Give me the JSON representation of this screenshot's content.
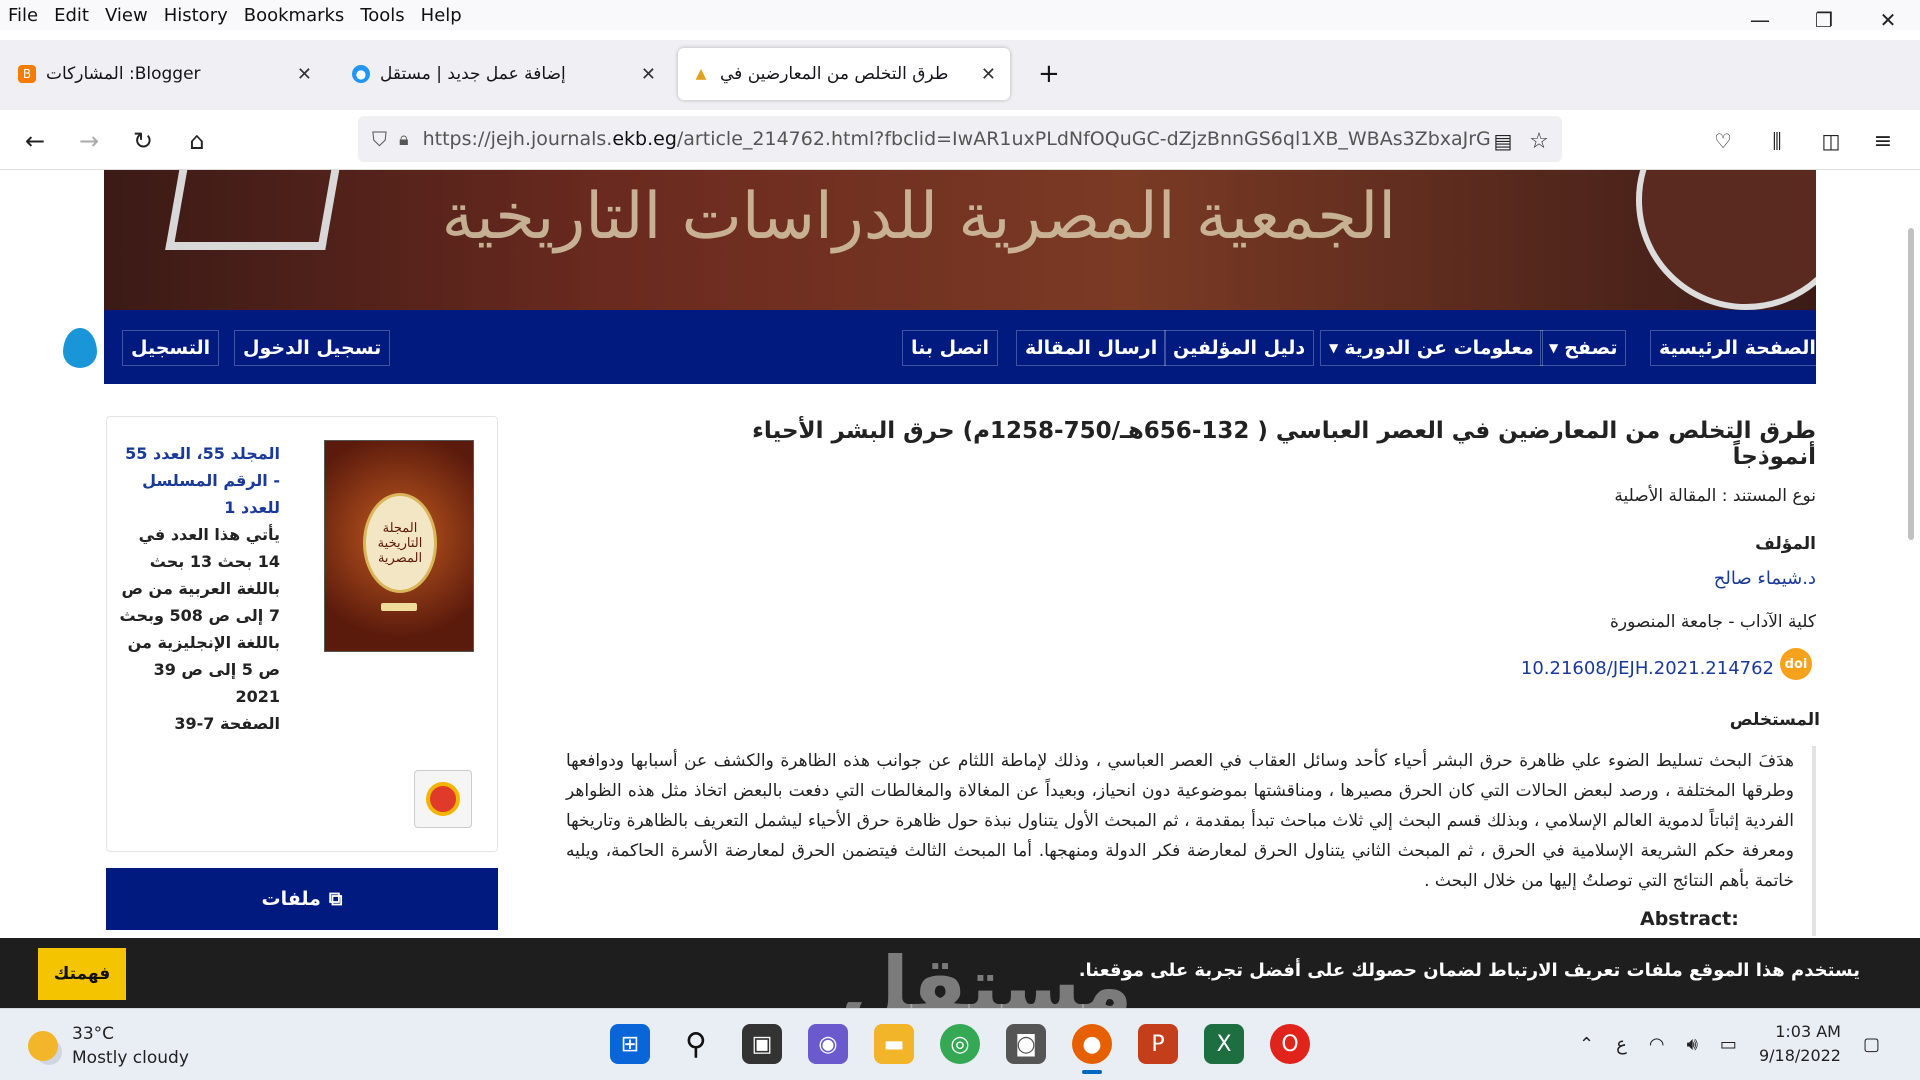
{
  "menu": [
    "File",
    "Edit",
    "View",
    "History",
    "Bookmarks",
    "Tools",
    "Help"
  ],
  "tabs": [
    {
      "title": "Blogger: المشاركات",
      "favicon": "blogger-icon",
      "color": "#f57c00"
    },
    {
      "title": "إضافة عمل جديد | مستقل",
      "favicon": "mostaql-icon",
      "color": "#2196f3"
    },
    {
      "title": "طرق التخلص من المعارضين في",
      "favicon": "journal-icon",
      "color": "#e0a020"
    }
  ],
  "new_tab": "+",
  "url": {
    "scheme": "https://jejh.journals.",
    "host": "ekb.eg",
    "path": "/article_214762.html?fbclid=IwAR1uxPLdNfOQuGC-dZjzBnnGS6ql1XB_WBAs3ZbxaJrG"
  },
  "banner": {
    "text": "الجمعية المصرية للدراسات التاريخية"
  },
  "site_nav": [
    "الصفحة الرئيسية",
    "تصفح",
    "معلومات عن الدورية",
    "دليل المؤلفين",
    "ارسال المقالة",
    "اتصل بنا",
    "تسجيل الدخول",
    "التسجيل"
  ],
  "article": {
    "title": "طرق التخلص من المعارضين في العصر العباسي ( 132-656هـ/750-1258م) حرق البشر الأحياء أنموذجاً",
    "doc_type": "نوع المستند : المقالة الأصلية",
    "author_label": "المؤلف",
    "author": "د.شيماء صالح",
    "affiliation": "كلية الآداب - جامعة المنصورة",
    "doi": "10.21608/JEJH.2021.214762",
    "doi_badge": "doi",
    "abstract_label": "المستخلص",
    "abstract": "هدَفَ البحث  تسليط الضوء علي ظاهرة  حرق البشر أحياء كأحد وسائل العقاب في العصر العباسي ، وذلك لإماطة اللثام عن جوانب هذه الظاهرة والكشف عن أسبابها ودوافعها وطرقها المختلفة ، ورصد لبعض الحالات التي كان الحرق مصيرها ، ومناقشتها بموضوعية دون انحياز،  وبعيداً عن المغالاة والمغالطات التي دفعت بالبعض اتخاذ مثل هذه الظواهر الفردية إثباتاً لدموية العالم الإسلامي ، وبذلك قسم البحث إلي ثلاث مباحث تبدأ بمقدمة ،  ثم  المبحث الأول يتناول نبذة حول ظاهرة حرق الأحياء ليشمل التعريف بالظاهرة وتاريخها ومعرفة حكم الشريعة الإسلامية في الحرق ،  ثم  المبحث الثاني يتناول الحرق لمعارضة فكر الدولة ومنهجها.  أما  المبحث الثالث فيتضمن الحرق لمعارضة الأسرة الحاكمة، ويليه خاتمة بأهم النتائج التي توصلتُ إليها من خلال البحث .",
    "abstract_en_label": "Abstract:"
  },
  "sidebar": {
    "cover_title": "المجلة التاريخية المصرية",
    "issue_link": "المجلد 55، العدد 55 - الرقم المسلسل للعدد 1",
    "issue_desc": "يأتي هذا العدد في 14 بحث 13 بحث باللغة العربية من ص 7 إلى ص 508 وبحث باللغة الإنجليزية من ص 5 إلى ص 39",
    "year": "2021",
    "pages": "الصفحة 7-39",
    "files_label": "ملفات"
  },
  "cookie": {
    "text": "يستخدم هذا الموقع ملفات تعريف الارتباط لضمان حصولك على أفضل تجربة على موقعنا.",
    "button": "فهمتك",
    "watermark": "مستقل"
  },
  "taskbar": {
    "temp": "33°C",
    "condition": "Mostly cloudy",
    "lang": "ع",
    "time": "1:03 AM",
    "date": "9/18/2022"
  }
}
